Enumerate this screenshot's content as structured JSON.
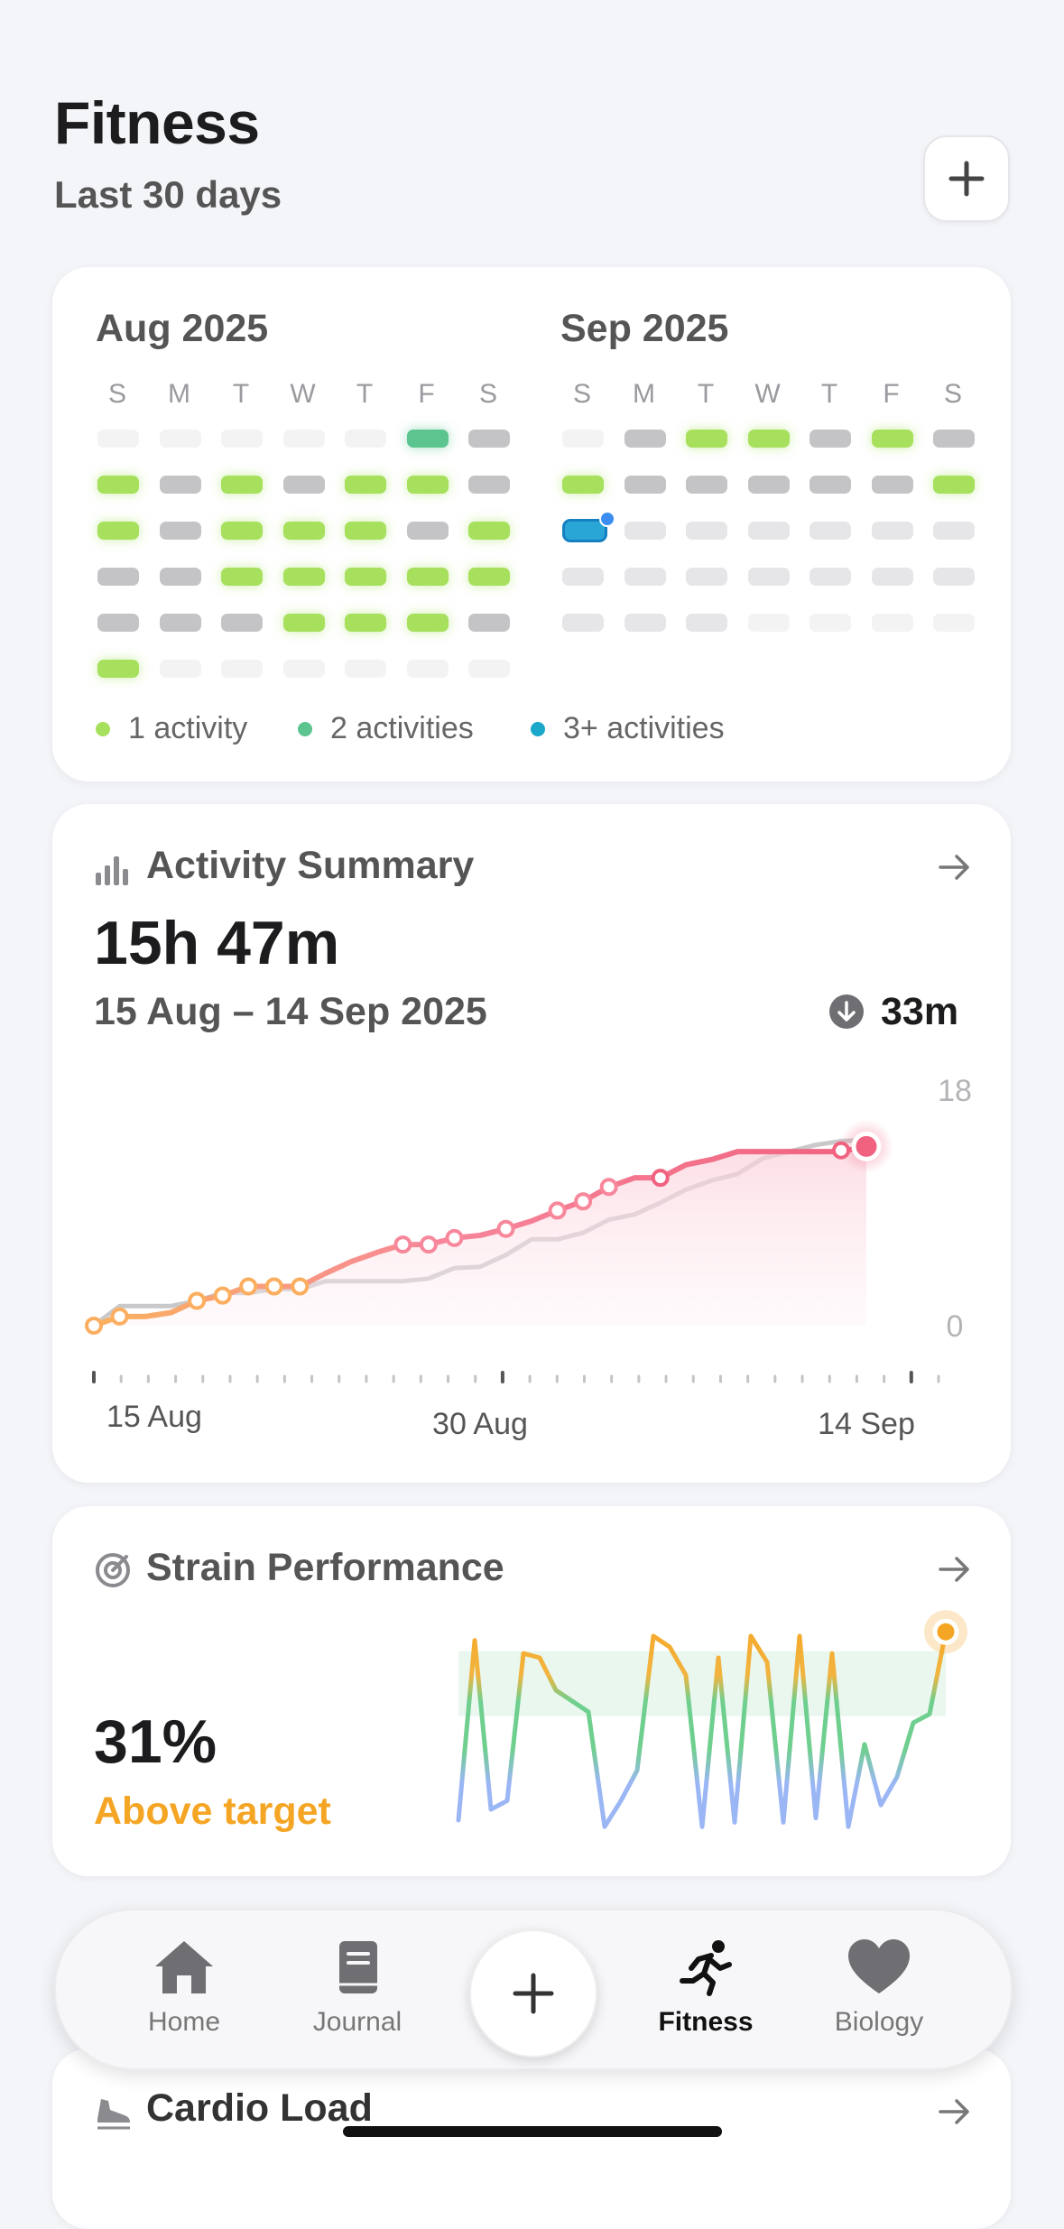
{
  "header": {
    "title": "Fitness",
    "subtitle": "Last 30 days",
    "add_icon": "plus-icon"
  },
  "calendar": {
    "weekdays": [
      "S",
      "M",
      "T",
      "W",
      "T",
      "F",
      "S"
    ],
    "months": [
      {
        "label": "Aug 2025",
        "rows": [
          [
            "none",
            "none",
            "none",
            "none",
            "none",
            "two",
            "rest"
          ],
          [
            "one",
            "rest",
            "one",
            "rest",
            "one",
            "one",
            "rest"
          ],
          [
            "one",
            "rest",
            "one",
            "one",
            "one",
            "rest",
            "one"
          ],
          [
            "rest",
            "rest",
            "one",
            "one",
            "one",
            "one",
            "one"
          ],
          [
            "rest",
            "rest",
            "rest",
            "one",
            "one",
            "one",
            "rest"
          ],
          [
            "one",
            "none",
            "none",
            "none",
            "none",
            "none",
            "none"
          ]
        ]
      },
      {
        "label": "Sep 2025",
        "today": [
          2,
          0
        ],
        "rows": [
          [
            "none",
            "rest",
            "one",
            "one",
            "rest",
            "one",
            "rest"
          ],
          [
            "one",
            "rest",
            "rest",
            "rest",
            "rest",
            "rest",
            "one"
          ],
          [
            "today",
            "future",
            "future",
            "future",
            "future",
            "future",
            "future"
          ],
          [
            "future",
            "future",
            "future",
            "future",
            "future",
            "future",
            "future"
          ],
          [
            "future",
            "future",
            "future",
            "none",
            "none",
            "none",
            "none"
          ]
        ]
      }
    ],
    "colors": {
      "one": "#a6e05c",
      "two": "#5cc48f",
      "three": "#1aa7c9",
      "rest": "#c4c4c6",
      "future": "#e6e6e8",
      "none": "#f3f3f4",
      "today": "#2aa6d6"
    },
    "legend": [
      {
        "label": "1 activity",
        "color": "#a6e05c"
      },
      {
        "label": "2 activities",
        "color": "#5cc48f"
      },
      {
        "label": "3+ activities",
        "color": "#1aa7c9"
      }
    ]
  },
  "activity_summary": {
    "title": "Activity Summary",
    "icon": "bar-chart-icon",
    "total": "15h 47m",
    "range": "15 Aug – 14 Sep 2025",
    "delta": "33m",
    "delta_icon": "arrow-down-circle-icon",
    "link_icon": "arrow-right-icon"
  },
  "strain": {
    "title": "Strain Performance",
    "icon": "target-icon",
    "value": "31%",
    "status": "Above target",
    "status_color": "#f5a524",
    "link_icon": "arrow-right-icon",
    "series": [
      0.05,
      0.88,
      0.1,
      0.14,
      0.82,
      0.8,
      0.65,
      0.6,
      0.55,
      0.02,
      0.14,
      0.28,
      0.9,
      0.85,
      0.72,
      0.02,
      0.8,
      0.04,
      0.9,
      0.78,
      0.04,
      0.9,
      0.06,
      0.82,
      0.02,
      0.4,
      0.12,
      0.25,
      0.5,
      0.54,
      0.92
    ],
    "band": [
      0.53,
      0.83
    ]
  },
  "chart_data": {
    "type": "line",
    "x": [
      "15 Aug",
      "16 Aug",
      "17 Aug",
      "18 Aug",
      "19 Aug",
      "20 Aug",
      "21 Aug",
      "22 Aug",
      "23 Aug",
      "24 Aug",
      "25 Aug",
      "26 Aug",
      "27 Aug",
      "28 Aug",
      "29 Aug",
      "30 Aug",
      "31 Aug",
      "1 Sep",
      "2 Sep",
      "3 Sep",
      "4 Sep",
      "5 Sep",
      "6 Sep",
      "7 Sep",
      "8 Sep",
      "9 Sep",
      "10 Sep",
      "11 Sep",
      "12 Sep",
      "13 Sep",
      "14 Sep"
    ],
    "x_tick_labels": [
      "15 Aug",
      "30 Aug",
      "14 Sep"
    ],
    "ylim": [
      0,
      18
    ],
    "y_tick_labels": [
      "18",
      "0"
    ],
    "series": [
      {
        "values": [
          0,
          0.7,
          0.7,
          1.0,
          1.9,
          2.3,
          3.0,
          3.0,
          3.0,
          4.0,
          4.9,
          5.6,
          6.2,
          6.2,
          6.7,
          6.9,
          7.4,
          8.0,
          8.8,
          9.5,
          10.6,
          11.3,
          11.3,
          12.3,
          12.7,
          13.3,
          13.3,
          13.3,
          13.3,
          13.3,
          13.7
        ],
        "active": [
          true,
          true,
          false,
          false,
          true,
          true,
          true,
          true,
          true,
          false,
          false,
          false,
          true,
          true,
          true,
          false,
          true,
          false,
          true,
          true,
          true,
          false,
          true,
          false,
          false,
          false,
          false,
          false,
          false,
          false,
          true
        ]
      },
      {
        "values": [
          0,
          1.5,
          1.5,
          1.5,
          1.9,
          2.5,
          2.5,
          2.8,
          2.8,
          3.4,
          3.4,
          3.4,
          3.4,
          3.6,
          4.4,
          4.5,
          5.4,
          6.6,
          6.6,
          7.1,
          8.1,
          8.5,
          9.4,
          10.4,
          11.1,
          11.6,
          12.8,
          13.3,
          13.8,
          14.1,
          14.2
        ]
      }
    ]
  },
  "nav": {
    "items": [
      {
        "label": "Home",
        "icon": "home-icon"
      },
      {
        "label": "Journal",
        "icon": "journal-icon"
      },
      {
        "label": "Fitness",
        "icon": "running-icon"
      },
      {
        "label": "Biology",
        "icon": "heart-icon"
      }
    ],
    "fab_icon": "plus-icon"
  },
  "cardio": {
    "title": "Cardio Load",
    "icon": "shoe-icon",
    "link_icon": "arrow-right-icon"
  }
}
